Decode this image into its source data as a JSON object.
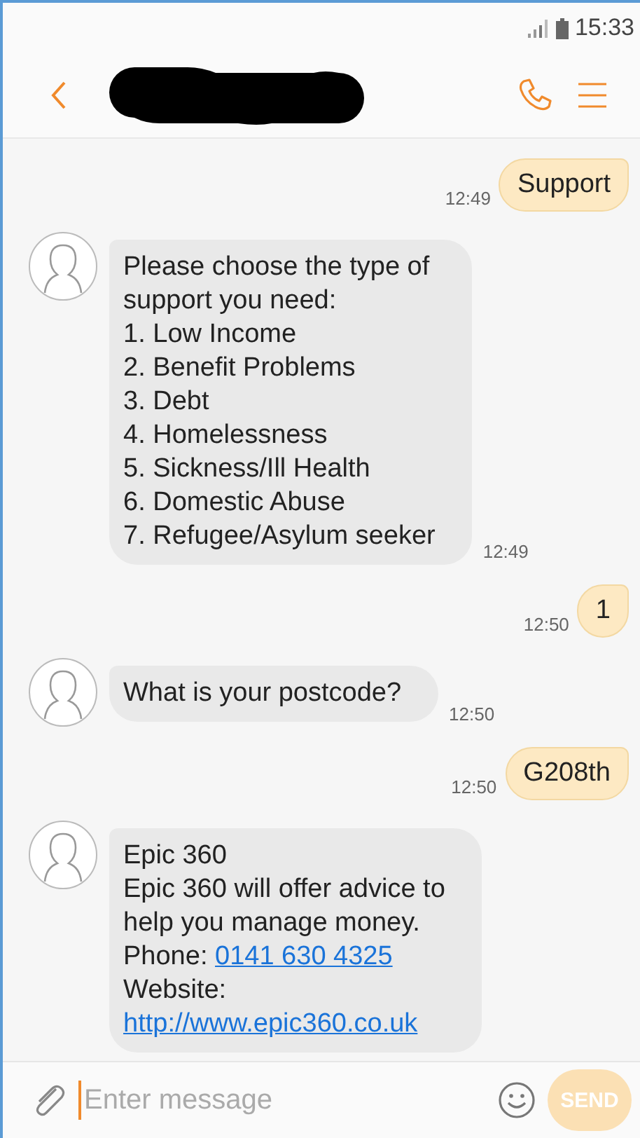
{
  "status_bar": {
    "time": "15:33"
  },
  "header": {
    "name_redacted": true
  },
  "messages": [
    {
      "kind": "sent",
      "lines": [
        {
          "text": "Support"
        }
      ],
      "time": "12:49"
    },
    {
      "kind": "received",
      "lines": [
        {
          "text": "Please choose the type of"
        },
        {
          "text": "support you need:"
        },
        {
          "text": "1. Low Income"
        },
        {
          "text": "2. Benefit Problems"
        },
        {
          "text": "3. Debt"
        },
        {
          "text": "4. Homelessness"
        },
        {
          "text": "5. Sickness/Ill Health"
        },
        {
          "text": "6. Domestic Abuse"
        },
        {
          "text": "7. Refugee/Asylum seeker"
        }
      ],
      "time": "12:49"
    },
    {
      "kind": "sent",
      "lines": [
        {
          "text": "1"
        }
      ],
      "time": "12:50"
    },
    {
      "kind": "received",
      "lines": [
        {
          "text": "What is your postcode?"
        }
      ],
      "time": "12:50"
    },
    {
      "kind": "sent",
      "lines": [
        {
          "text": "G208th"
        }
      ],
      "time": "12:50"
    },
    {
      "kind": "received",
      "lines": [
        {
          "text": "Epic 360"
        },
        {
          "text": "Epic 360 will offer advice to"
        },
        {
          "text": "help you manage money."
        },
        {
          "text": "Phone:",
          "link": "0141 630 4325"
        },
        {
          "text": "Website:"
        },
        {
          "link": "http://www.epic360.co.uk"
        }
      ]
    }
  ],
  "composer": {
    "placeholder": "Enter message",
    "send_label": "SEND",
    "send_disabled": true
  }
}
